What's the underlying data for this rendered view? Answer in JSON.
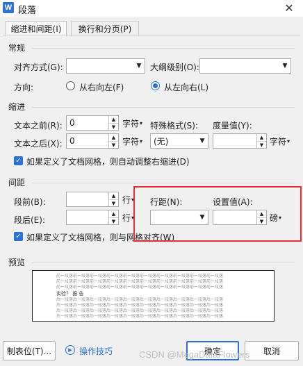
{
  "window": {
    "title": "段落",
    "icon_glyph": "W"
  },
  "tabs": [
    {
      "label": "缩进和间距(I)",
      "active": true
    },
    {
      "label": "换行和分页(P)",
      "active": false
    }
  ],
  "general": {
    "title": "常规",
    "alignment_label": "对齐方式(G):",
    "alignment_value": "",
    "outline_label": "大纲级别(O):",
    "outline_value": "",
    "direction_label": "方向:",
    "rtl_label": "从右向左(F)",
    "ltr_label": "从左向右(L)",
    "selected_direction": "ltr"
  },
  "indent": {
    "title": "缩进",
    "before_label": "文本之前(R):",
    "before_value": "0",
    "before_unit": "字符",
    "after_label": "文本之后(X):",
    "after_value": "0",
    "after_unit": "字符",
    "special_label": "特殊格式(S):",
    "special_value": "(无)",
    "measure_label": "度量值(Y):",
    "measure_value": "",
    "measure_unit": "字符",
    "auto_adjust_label": "如果定义了文档网格，则自动调整右缩进(D)",
    "auto_adjust_checked": true
  },
  "spacing": {
    "title": "间距",
    "before_label": "段前(B):",
    "before_value": "",
    "before_unit": "行",
    "after_label": "段后(E):",
    "after_value": "",
    "after_unit": "行",
    "line_spacing_label": "行距(N):",
    "line_spacing_value": "",
    "set_value_label": "设置值(A):",
    "set_value": "",
    "set_value_unit": "磅",
    "snap_grid_label": "如果定义了文档网格，则与网格对齐(W)",
    "snap_grid_checked": true
  },
  "preview": {
    "title": "预览",
    "prev_line": "前一段落前一段落前一段落前一段落前一段落前一段落前一段落前一段落前一段落前一段落",
    "sample_text": "实验？ 报 告",
    "next_line": "后一段落后一段落后一段落后一段落后一段落后一段落后一段落后一段落后一段落后一段落"
  },
  "footer": {
    "tabs_button": "制表位(T)...",
    "tips_label": "操作技巧",
    "ok_button": "确定",
    "cancel_button": "取消"
  },
  "watermark": "CSDN @MegaDataFlowers",
  "colors": {
    "accent": "#2c72d8",
    "annotation": "#e53030"
  }
}
